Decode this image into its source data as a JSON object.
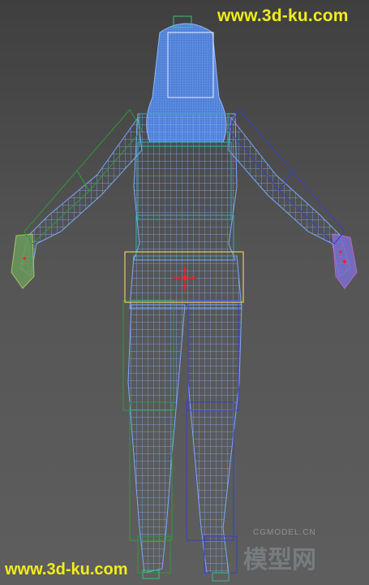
{
  "viewport": {
    "background_top": "#3f3f3f",
    "background_bottom": "#5e5e5e",
    "mesh_color": "#6fa3ff",
    "bone_green": "#2e9a3a",
    "bone_teal": "#2fb0b0",
    "bone_blue": "#3b3fc4",
    "selection_yellow": "#e8cc5a",
    "pivot_red": "#ff2020"
  },
  "watermarks": {
    "top": "www.3d-ku.com",
    "bottom": "www.3d-ku.com",
    "cgmodel_small": "CGMODEL.CN",
    "cgmodel_big": "模型网",
    "color": "#f2ee1a"
  }
}
